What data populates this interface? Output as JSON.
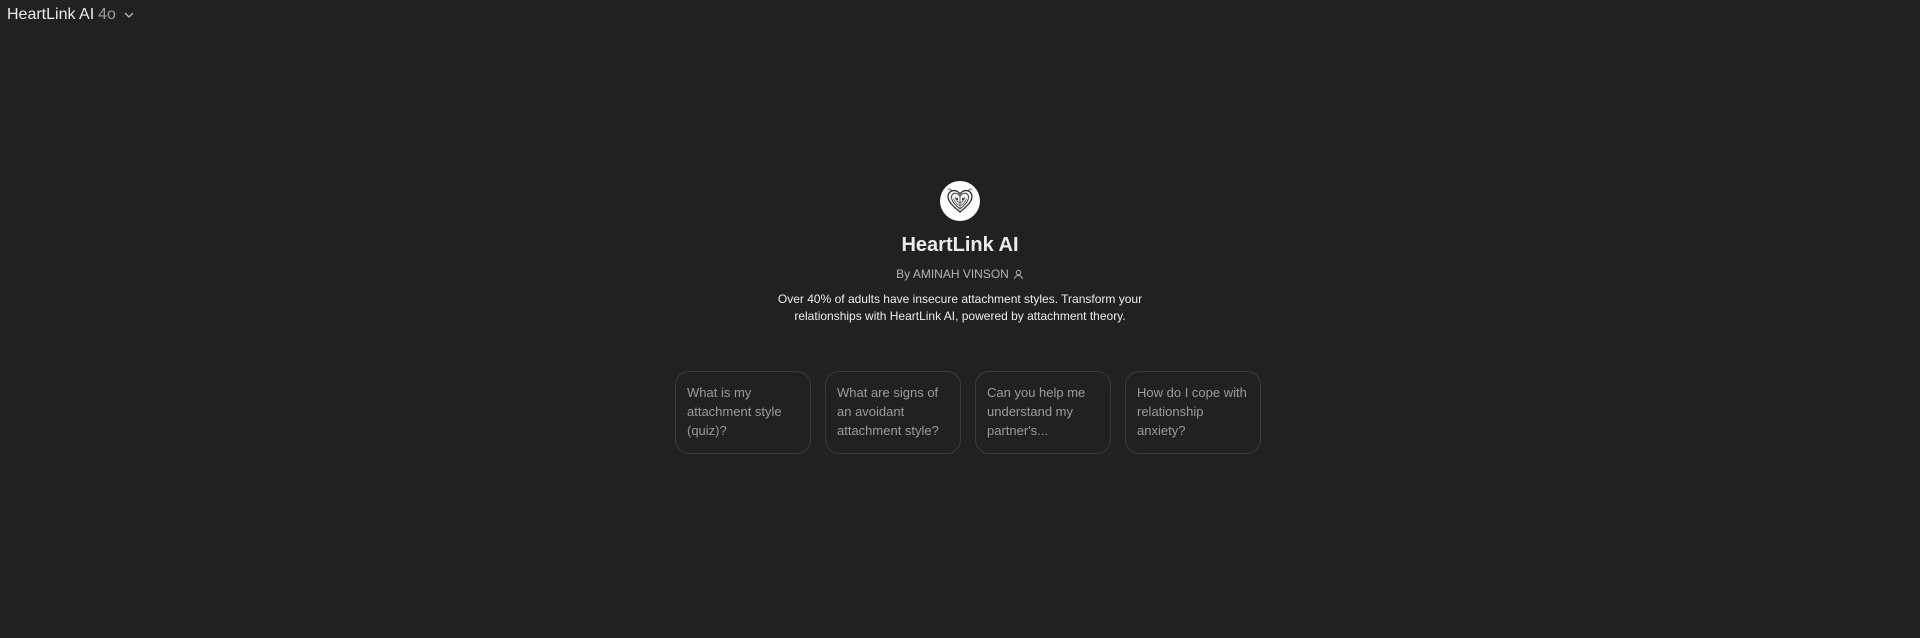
{
  "header": {
    "model_name": "HeartLink AI",
    "model_version": "4o",
    "dropdown_icon": "chevron-down-icon"
  },
  "gpt": {
    "avatar_icon": "heart-logo",
    "title": "HeartLink AI",
    "author": "By AMINAH VINSON",
    "author_icon": "person-icon",
    "description": "Over 40% of adults have insecure attachment styles. Transform your relationships with HeartLink AI, powered by attachment theory."
  },
  "starters": [
    {
      "text": "What is my attachment style (quiz)?"
    },
    {
      "text": "What are signs of an avoidant attachment style?"
    },
    {
      "text": "Can you help me understand my partner's..."
    },
    {
      "text": "How do I cope with relationship anxiety?"
    }
  ],
  "colors": {
    "background": "#212121",
    "text_primary": "#ececec",
    "text_secondary": "#9b9b9b",
    "card_border": "#3a3a3a"
  }
}
